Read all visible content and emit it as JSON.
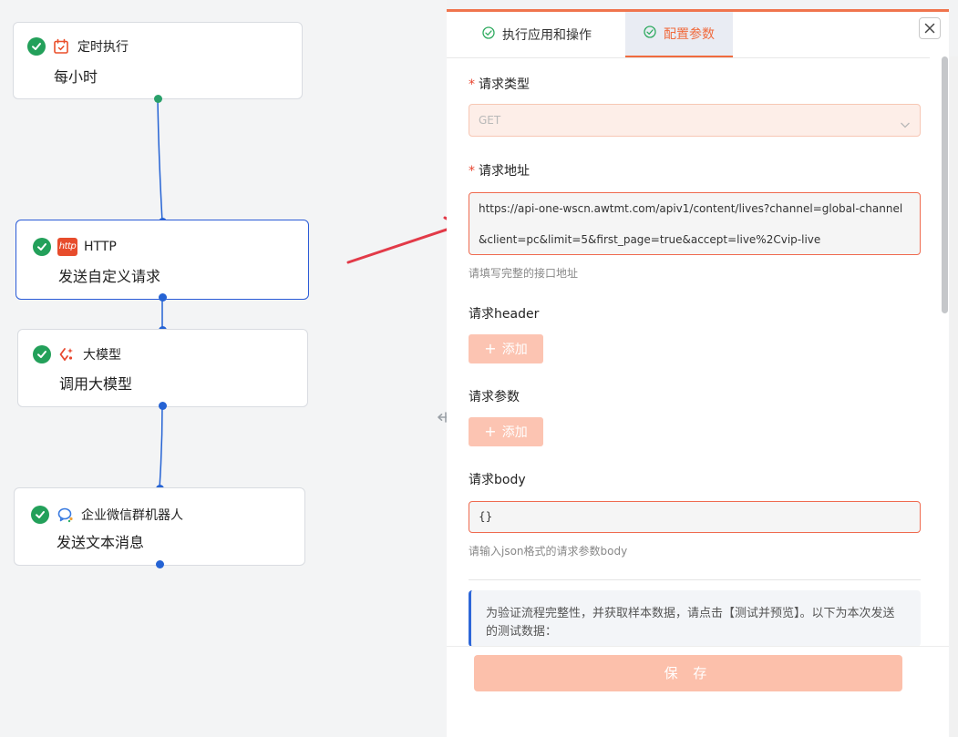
{
  "canvas": {
    "nodes": [
      {
        "label": "定时执行",
        "sub": "每小时",
        "icon": "calendar-icon"
      },
      {
        "label": "HTTP",
        "sub": "发送自定义请求",
        "icon": "http-icon",
        "icon_text": "http"
      },
      {
        "label": "大模型",
        "sub": "调用大模型",
        "icon": "sparkle-icon"
      },
      {
        "label": "企业微信群机器人",
        "sub": "发送文本消息",
        "icon": "chat-bubble-icon"
      }
    ]
  },
  "panel": {
    "tabs": [
      {
        "label": "执行应用和操作",
        "active": false
      },
      {
        "label": "配置参数",
        "active": true
      }
    ],
    "request_type": {
      "label": "请求类型",
      "value": "GET"
    },
    "request_url": {
      "label": "请求地址",
      "value": "https://api-one-wscn.awtmt.com/apiv1/content/lives?channel=global-channel&client=pc&limit=5&first_page=true&accept=live%2Cvip-live",
      "hint": "请填写完整的接口地址"
    },
    "request_header": {
      "label": "请求header",
      "add_label": "添加"
    },
    "request_params": {
      "label": "请求参数",
      "add_label": "添加"
    },
    "request_body": {
      "label": "请求body",
      "value": "{}",
      "hint": "请输入json格式的请求参数body"
    },
    "info_text": "为验证流程完整性，并获取样本数据，请点击【测试并预览】。以下为本次发送的测试数据：",
    "save_label": "保 存"
  },
  "colors": {
    "accent": "#f06b3e",
    "selected_border": "#2a5bd7",
    "success": "#23a05a",
    "arrow": "#e23a48"
  }
}
